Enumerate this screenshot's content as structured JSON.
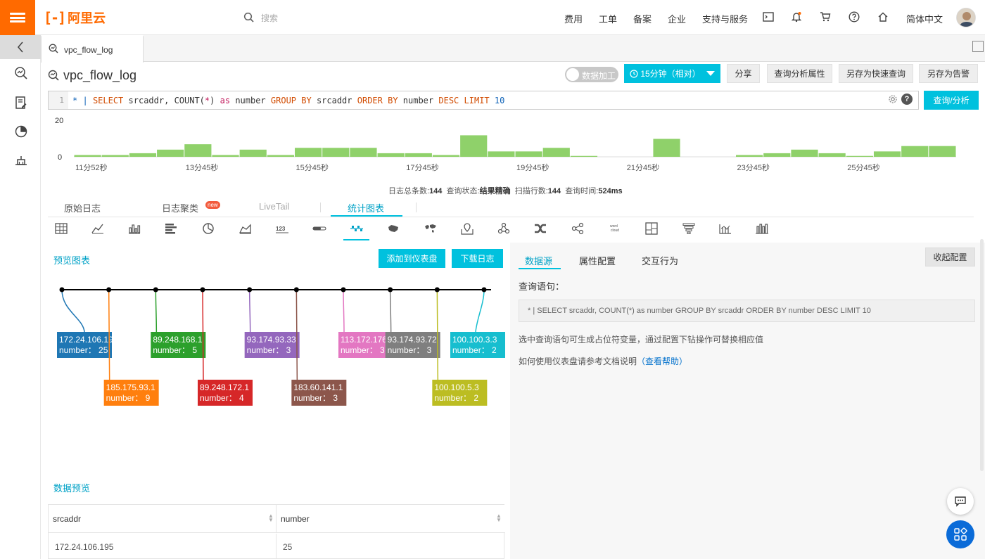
{
  "topnav": {
    "logo_text": "阿里云",
    "search_placeholder": "搜索",
    "links": [
      "费用",
      "工单",
      "备案",
      "企业",
      "支持与服务"
    ],
    "language": "简体中文"
  },
  "tab": {
    "label": "vpc_flow_log"
  },
  "header": {
    "title": "vpc_flow_log",
    "toggle_label": "数据加工",
    "time_range": "15分钟（相对）",
    "share": "分享",
    "query_props": "查询分析属性",
    "save_quick": "另存为快速查询",
    "save_alert": "另存为告警"
  },
  "query": {
    "line_no": "1",
    "star": "*",
    "pipe": "|",
    "select": "SELECT",
    "col1": "srcaddr,",
    "count": "COUNT(",
    "star2": "*",
    "close": ")",
    "as": "as",
    "number": "number",
    "group_by": "GROUP BY",
    "col2": "srcaddr",
    "order_by": "ORDER BY",
    "col3": "number",
    "desc": "DESC",
    "limit": "LIMIT",
    "limit_val": "10",
    "button": "查询/分析"
  },
  "histogram": {
    "y_max_label": "20",
    "y_min_label": "0",
    "x_labels": [
      "11分52秒",
      "13分45秒",
      "15分45秒",
      "17分45秒",
      "19分45秒",
      "21分45秒",
      "23分45秒",
      "25分45秒"
    ],
    "values": [
      1,
      1,
      2,
      4,
      7,
      1,
      4,
      1,
      5,
      5,
      5,
      2,
      2,
      1,
      12,
      3,
      3,
      5,
      0.5,
      0,
      0,
      10,
      0,
      0,
      1,
      2,
      4,
      2,
      0.5,
      3,
      6,
      6
    ],
    "color": "#8fd16a"
  },
  "summary": {
    "total_label": "日志总条数:",
    "total": "144",
    "status_label": "查询状态:",
    "status": "结果精确",
    "scanned_label": "扫描行数:",
    "scanned": "144",
    "time_label": "查询时间:",
    "time": "524ms"
  },
  "view_tabs": {
    "raw": "原始日志",
    "cluster": "日志聚类",
    "new_badge": "new",
    "livetail": "LiveTail",
    "stats": "统计图表"
  },
  "chart_icons": [
    "table-icon",
    "line-chart-icon",
    "bar-chart-icon",
    "horizontal-bar-icon",
    "pie-chart-icon",
    "area-chart-icon",
    "number-icon",
    "progress-bar-icon",
    "timeline-icon",
    "china-map-icon",
    "world-map-icon",
    "gaode-map-icon",
    "flow-chart-icon",
    "sankey-icon",
    "force-graph-icon",
    "word-cloud-icon",
    "treemap-icon",
    "funnel-icon",
    "domain-monitor-icon",
    "column-chart-icon"
  ],
  "preview": {
    "title": "预览图表",
    "add_dashboard": "添加到仪表盘",
    "download": "下载日志",
    "data_preview_title": "数据预览"
  },
  "chart_data": {
    "type": "timeline",
    "x_field": "srcaddr",
    "y_field": "number",
    "items": [
      {
        "label": "172.24.106.195",
        "shown": "172.24.106.19",
        "value": 25,
        "color": "#1f77b4",
        "pos": "top"
      },
      {
        "label": "185.175.93.1",
        "shown": "185.175.93.1",
        "value": 9,
        "color": "#ff7f0e",
        "pos": "bottom"
      },
      {
        "label": "89.248.168.1",
        "shown": "89.248.168.1",
        "value": 5,
        "color": "#2ca02c",
        "pos": "top"
      },
      {
        "label": "89.248.172.1",
        "shown": "89.248.172.1",
        "value": 4,
        "color": "#d62728",
        "pos": "bottom"
      },
      {
        "label": "93.174.93.33",
        "shown": "93.174.93.33",
        "value": 3,
        "color": "#9467bd",
        "pos": "top"
      },
      {
        "label": "183.60.141.1",
        "shown": "183.60.141.1",
        "value": 3,
        "color": "#8c564b",
        "pos": "bottom"
      },
      {
        "label": "113.172.176",
        "shown": "113.172.176",
        "value": 3,
        "color": "#e377c2",
        "pos": "top"
      },
      {
        "label": "93.174.93.72",
        "shown": "93.174.93.72",
        "value": 3,
        "color": "#7f7f7f",
        "pos": "top"
      },
      {
        "label": "100.100.5.3",
        "shown": "100.100.5.3",
        "value": 2,
        "color": "#bcbd22",
        "pos": "bottom"
      },
      {
        "label": "100.100.3.3",
        "shown": "100.100.3.3",
        "value": 2,
        "color": "#17becf",
        "pos": "top"
      }
    ],
    "value_prefix": "number： "
  },
  "table": {
    "columns": [
      "srcaddr",
      "number"
    ],
    "rows": [
      [
        "172.24.106.195",
        "25"
      ]
    ]
  },
  "config": {
    "tabs": [
      "数据源",
      "属性配置",
      "交互行为"
    ],
    "collapse": "收起配置",
    "query_label": "查询语句：",
    "query_sql": "* | SELECT srcaddr, COUNT(*) as number GROUP BY srcaddr ORDER BY number DESC LIMIT 10",
    "hint": "选中查询语句可生成占位符变量，通过配置下钻操作可替换相应值",
    "help_prefix": "如何使用仪表盘请参考文档说明",
    "help_link": "（查看帮助）"
  }
}
